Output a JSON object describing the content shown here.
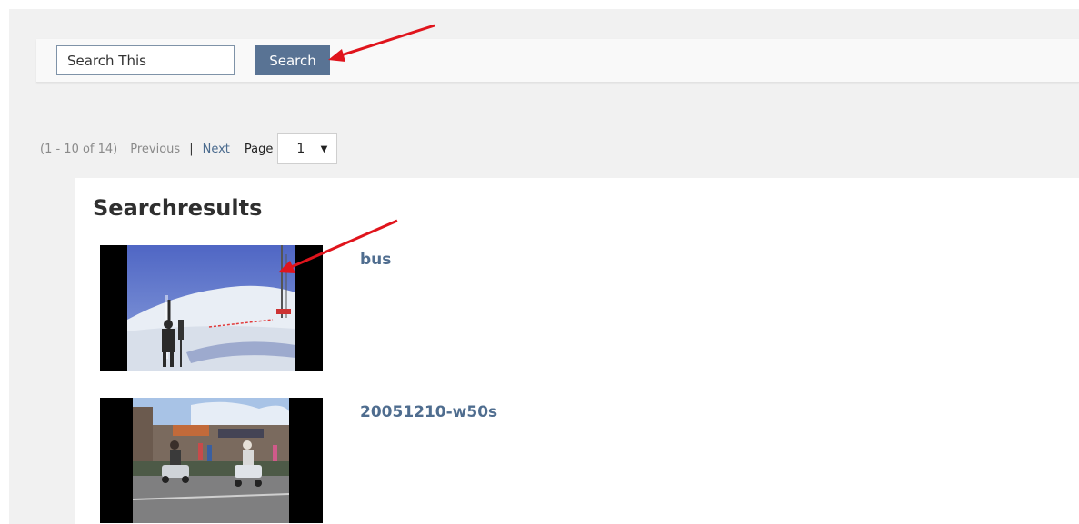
{
  "search": {
    "input_value": "Search This",
    "button_label": "Search"
  },
  "pager": {
    "range": "(1 - 10 of 14)",
    "previous": "Previous",
    "separator": "|",
    "next": "Next",
    "page_label": "Page",
    "current_page": "1"
  },
  "results": {
    "heading": "Searchresults",
    "items": [
      {
        "title": "bus",
        "thumbnail": "ski-slope-video-thumbnail"
      },
      {
        "title": "20051210-w50s",
        "thumbnail": "street-scooters-video-thumbnail"
      }
    ]
  },
  "colors": {
    "accent": "#597394",
    "link": "#4f6d8f",
    "annotation_arrow": "#e0141c"
  }
}
